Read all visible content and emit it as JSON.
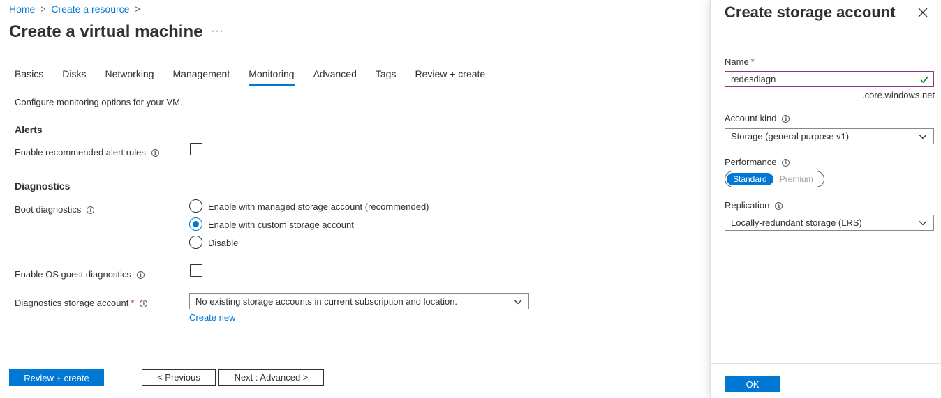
{
  "breadcrumb": {
    "home": "Home",
    "create_resource": "Create a resource",
    "separator": ">"
  },
  "page": {
    "title": "Create a virtual machine",
    "more": "···"
  },
  "tabs": [
    {
      "label": "Basics"
    },
    {
      "label": "Disks"
    },
    {
      "label": "Networking"
    },
    {
      "label": "Management"
    },
    {
      "label": "Monitoring",
      "active": true
    },
    {
      "label": "Advanced"
    },
    {
      "label": "Tags"
    },
    {
      "label": "Review + create"
    }
  ],
  "monitoring": {
    "description": "Configure monitoring options for your VM.",
    "alerts_title": "Alerts",
    "alert_rules_label": "Enable recommended alert rules",
    "alert_rules_checked": false,
    "diagnostics_title": "Diagnostics",
    "boot_diag_label": "Boot diagnostics",
    "boot_options": [
      {
        "label": "Enable with managed storage account (recommended)",
        "selected": false
      },
      {
        "label": "Enable with custom storage account",
        "selected": true
      },
      {
        "label": "Disable",
        "selected": false
      }
    ],
    "os_guest_label": "Enable OS guest diagnostics",
    "os_guest_checked": false,
    "storage_label": "Diagnostics storage account",
    "storage_required": "*",
    "storage_value": "No existing storage accounts in current subscription and location.",
    "create_new": "Create new"
  },
  "footer": {
    "review_create": "Review + create",
    "previous": "< Previous",
    "next": "Next : Advanced >"
  },
  "panel": {
    "title": "Create storage account",
    "name_label": "Name",
    "name_required": "*",
    "name_value": "redesdiagn",
    "name_suffix": ".core.windows.net",
    "account_kind_label": "Account kind",
    "account_kind_value": "Storage (general purpose v1)",
    "performance_label": "Performance",
    "performance_options": [
      "Standard",
      "Premium"
    ],
    "performance_selected": "Standard",
    "replication_label": "Replication",
    "replication_value": "Locally-redundant storage (LRS)",
    "ok": "OK"
  },
  "colors": {
    "accent": "#0078d4",
    "text": "#323130",
    "required": "#a4262c",
    "valid": "#107c10"
  },
  "icons": {
    "info": "info-icon",
    "chevron": "chevron-down-icon",
    "close": "close-icon",
    "check": "checkmark-icon"
  }
}
